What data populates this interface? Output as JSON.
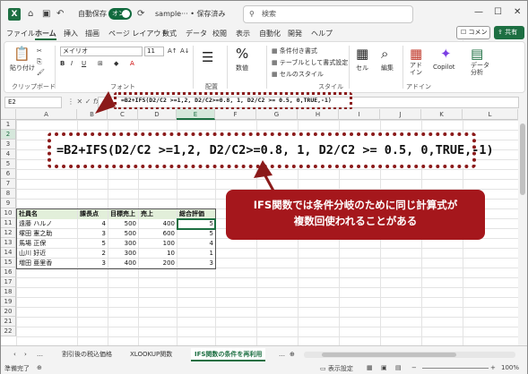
{
  "titlebar": {
    "autosave_label": "自動保存",
    "autosave_state": "オン",
    "filename": "sample··· • 保存済み",
    "search_placeholder": "検索"
  },
  "menu": [
    "ファイル",
    "ホーム",
    "挿入",
    "描画",
    "ページ レイアウト",
    "数式",
    "データ",
    "校閲",
    "表示",
    "自動化",
    "開発",
    "ヘルプ"
  ],
  "menu_active": "ホーム",
  "comment_label": "コメント",
  "share_label": "共有",
  "ribbon": {
    "paste": "貼り付け",
    "clipboard": "クリップボード",
    "font_name": "メイリオ",
    "font_size": "11",
    "font_group": "フォント",
    "align_group": "配置",
    "number": "数値",
    "cond_format": "条件付き書式",
    "table_format": "テーブルとして書式設定",
    "cell_style": "セルのスタイル",
    "style_group": "スタイル",
    "cell": "セル",
    "edit": "編集",
    "addin": "アド\nイン",
    "addin_group": "アドイン",
    "copilot": "Copilot",
    "analyze": "データ\n分析"
  },
  "formula_bar": {
    "name_box": "E2",
    "formula": "=B2+IFS(D2/C2 >=1,2, D2/C2>=0.8, 1, D2/C2 >= 0.5, 0,TRUE,-1)"
  },
  "callout_formula": "=B2+IFS(D2/C2 >=1,2, D2/C2>=0.8, 1, D2/C2 >= 0.5, 0,TRUE,-1)",
  "annotation": {
    "line1": "IFS関数では条件分岐のために同じ計算式が",
    "line2": "複数回使われることがある"
  },
  "columns": [
    "A",
    "B",
    "C",
    "D",
    "E",
    "F",
    "G",
    "H",
    "I",
    "J",
    "K",
    "L"
  ],
  "rows": [
    "1",
    "2",
    "3",
    "4",
    "5",
    "6",
    "7",
    "8",
    "9",
    "10",
    "11",
    "12",
    "13",
    "14",
    "15",
    "16",
    "17",
    "18",
    "19",
    "20",
    "21",
    "22"
  ],
  "table": {
    "headers": [
      "社員名",
      "課長点",
      "目標売上",
      "売上",
      "総合評価"
    ],
    "rows": [
      [
        "遠藤 ハルノ",
        "4",
        "500",
        "400",
        "5"
      ],
      [
        "塚田 憲之助",
        "3",
        "500",
        "600",
        "5"
      ],
      [
        "馬場 正保",
        "5",
        "300",
        "100",
        "4"
      ],
      [
        "山川 好近",
        "2",
        "300",
        "10",
        "1"
      ],
      [
        "増田 亜里香",
        "3",
        "400",
        "200",
        "3"
      ]
    ]
  },
  "sheet_tabs": [
    "割引後の税込価格",
    "XLOOKUP関数",
    "IFS関数の条件を再利用"
  ],
  "active_sheet": "IFS関数の条件を再利用",
  "status": {
    "ready": "準備完了",
    "display_settings": "表示設定",
    "zoom": "100%"
  },
  "colors": {
    "excel_green": "#1d6f42",
    "callout_red": "#a5171c",
    "header_fill": "#e2efda"
  }
}
